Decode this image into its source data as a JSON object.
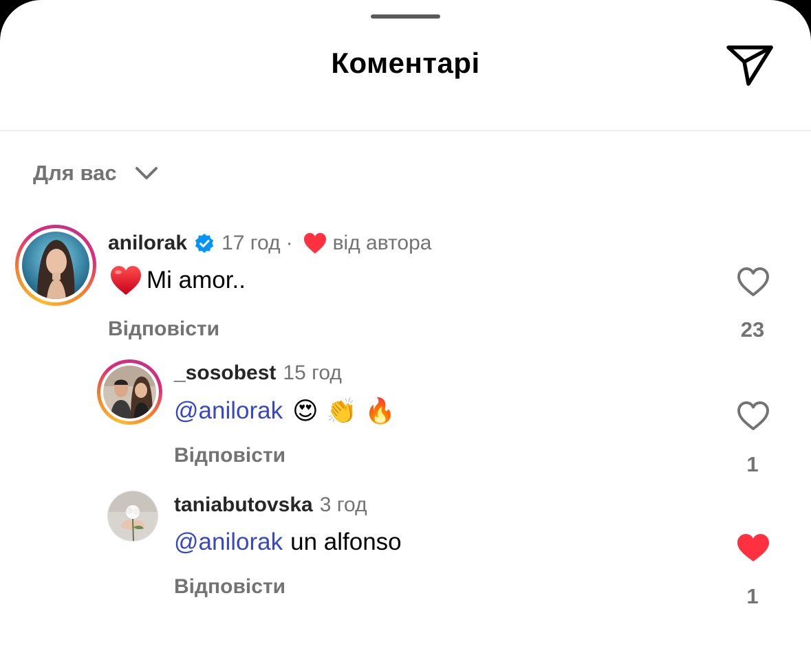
{
  "header": {
    "title": "Коментарі"
  },
  "filter": {
    "label": "Для вас"
  },
  "comments": [
    {
      "username": "anilorak",
      "verified": true,
      "time": "17 год",
      "separator": "·",
      "liked_by_author_label": "від автора",
      "text": "Mi amor..",
      "reply_label": "Відповісти",
      "like_count": "23",
      "liked": false
    },
    {
      "username": "_sosobest",
      "time": "15 год",
      "mention": "@anilorak",
      "emojis": "😍 👏 🔥",
      "reply_label": "Відповісти",
      "like_count": "1",
      "liked": false
    },
    {
      "username": "taniabutovska",
      "time": "3 год",
      "mention": "@anilorak",
      "text": "un alfonso",
      "reply_label": "Відповісти",
      "like_count": "1",
      "liked": true
    }
  ],
  "colors": {
    "mention": "#3847c6",
    "like_red": "#ff3040",
    "verified_blue": "#0095f6",
    "secondary_text": "#737373"
  }
}
